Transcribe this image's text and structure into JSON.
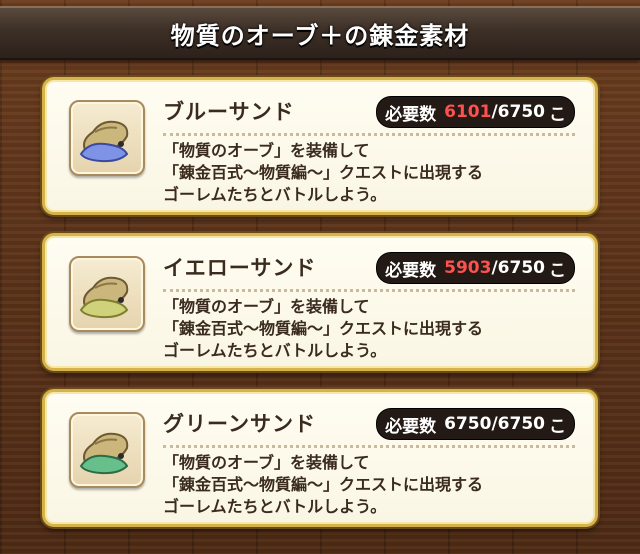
{
  "header": {
    "title": "物質のオーブ＋の錬金素材"
  },
  "requirement_label": "必要数",
  "unit": "こ",
  "items": [
    {
      "name": "ブルーサンド",
      "current": "6101",
      "total": "/6750",
      "description": [
        "「物質のオーブ」を装備して",
        "「錬金百式～物質編～」クエストに出現する",
        "ゴーレムたちとバトルしよう。"
      ],
      "icon": "blue-sand-bag-icon",
      "color": "#7f93e6"
    },
    {
      "name": "イエローサンド",
      "current": "5903",
      "total": "/6750",
      "description": [
        "「物質のオーブ」を装備して",
        "「錬金百式～物質編～」クエストに出現する",
        "ゴーレムたちとバトルしよう。"
      ],
      "icon": "yellow-sand-bag-icon",
      "color": "#cfd27a"
    },
    {
      "name": "グリーンサンド",
      "current": "6750",
      "total": "/6750",
      "description": [
        "「物質のオーブ」を装備して",
        "「錬金百式～物質編～」クエストに出現する",
        "ゴーレムたちとバトルしよう。"
      ],
      "icon": "green-sand-bag-icon",
      "color": "#67c08b"
    }
  ],
  "colors": {
    "shortfall": "#ff5050",
    "card_border": "#d5b24a"
  }
}
